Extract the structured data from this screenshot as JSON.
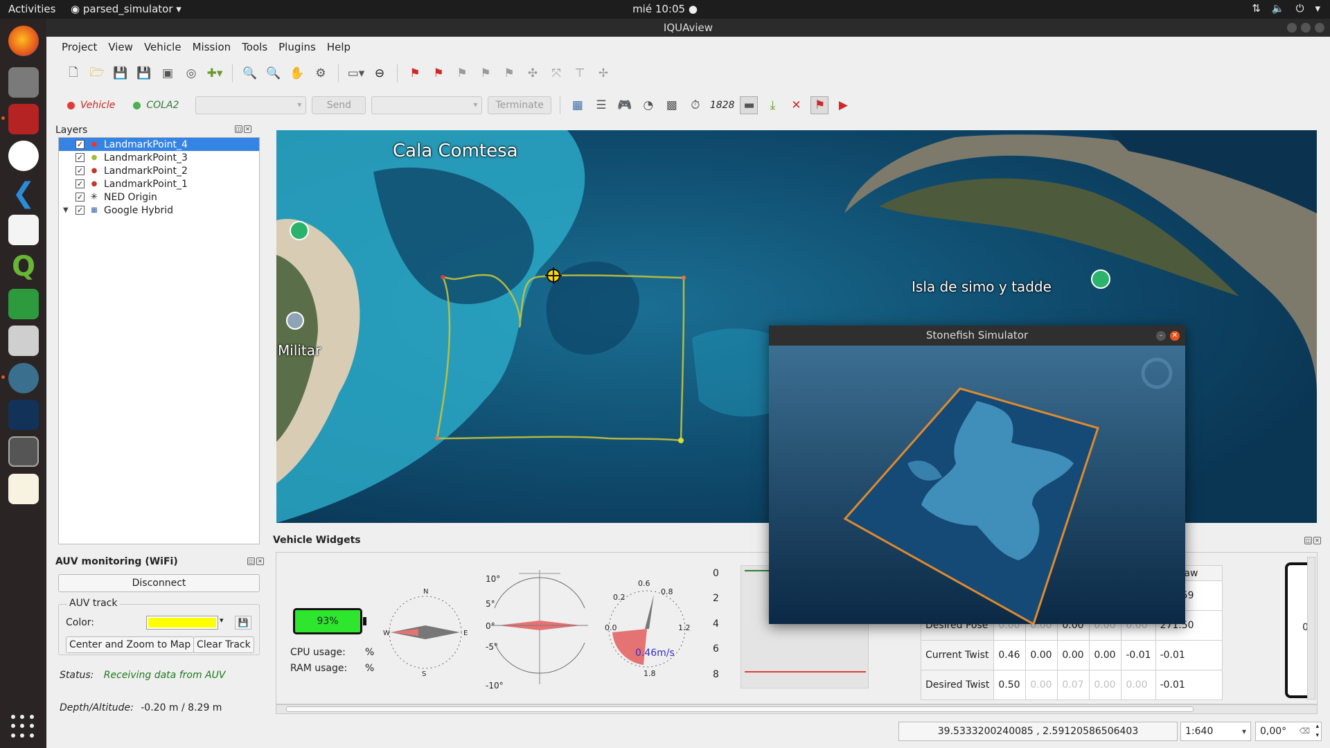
{
  "topbar": {
    "activities": "Activities",
    "app_name": "parsed_simulator",
    "clock": "mié 10:05"
  },
  "window": {
    "title": "IQUAview"
  },
  "menu": [
    "Project",
    "View",
    "Vehicle",
    "Mission",
    "Tools",
    "Plugins",
    "Help"
  ],
  "connection": {
    "vehicle_label": "Vehicle",
    "cola2_label": "COLA2",
    "send_label": "Send",
    "terminate_label": "Terminate",
    "counter": "1828",
    "vehicle_color": "#e53935",
    "cola2_color": "#4caf50"
  },
  "layers": {
    "title": "Layers",
    "items": [
      {
        "label": "LandmarkPoint_4",
        "selected": true,
        "symbol_color": "#e53935"
      },
      {
        "label": "LandmarkPoint_3",
        "selected": false,
        "symbol_color": "#9bbf3a"
      },
      {
        "label": "LandmarkPoint_2",
        "selected": false,
        "symbol_color": "#c0392b"
      },
      {
        "label": "LandmarkPoint_1",
        "selected": false,
        "symbol_color": "#c0392b"
      },
      {
        "label": "NED Origin",
        "selected": false,
        "symbol_color": "#222222"
      },
      {
        "label": "Google Hybrid",
        "selected": false,
        "symbol_color": "#2a5caa"
      }
    ]
  },
  "auv": {
    "title": "AUV monitoring (WiFi)",
    "disconnect": "Disconnect",
    "track_group": "AUV track",
    "color_label": "Color:",
    "track_color": "#ffff00",
    "center_button": "Center and Zoom to Map",
    "clear_button": "Clear Track",
    "status_label": "Status:",
    "status_value": "Receiving data from AUV",
    "depth_label": "Depth/Altitude:",
    "depth_value": "-0.20 m / 8.29 m"
  },
  "map": {
    "labels": [
      "Cala Comtesa",
      "Isla de simo y tadde",
      "Militar"
    ]
  },
  "widgets": {
    "title": "Vehicle Widgets",
    "battery": "93%",
    "battery_level": 0.93,
    "cpu_label": "CPU usage:",
    "ram_label": "RAM usage:",
    "percent": "%",
    "speed": "0.46m/s",
    "depth_ticks": [
      "0",
      "2",
      "4",
      "6",
      "8"
    ],
    "table": {
      "header": [
        "",
        "",
        "",
        "",
        "",
        "",
        "Yaw"
      ],
      "rows": [
        {
          "name": "",
          "values": [
            "",
            "",
            "",
            "",
            "",
            "271.59"
          ]
        },
        {
          "name": "Desired Pose",
          "values": [
            "0.00",
            "0.00",
            "0.00",
            "0.00",
            "0.00",
            "271.50"
          ]
        },
        {
          "name": "Current Twist",
          "values": [
            "0.46",
            "0.00",
            "0.00",
            "0.00",
            "-0.01",
            "-0.01"
          ]
        },
        {
          "name": "Desired Twist",
          "values": [
            "0.50",
            "0.00",
            "0.07",
            "0.00",
            "0.00",
            "-0.01"
          ]
        }
      ]
    },
    "side_value": "0"
  },
  "stonefish": {
    "title": "Stonefish Simulator"
  },
  "statusbar": {
    "coordinates": "39.5333200240085 , 2.59120586506403",
    "scale": "1:640",
    "rotation": "0,00°"
  }
}
